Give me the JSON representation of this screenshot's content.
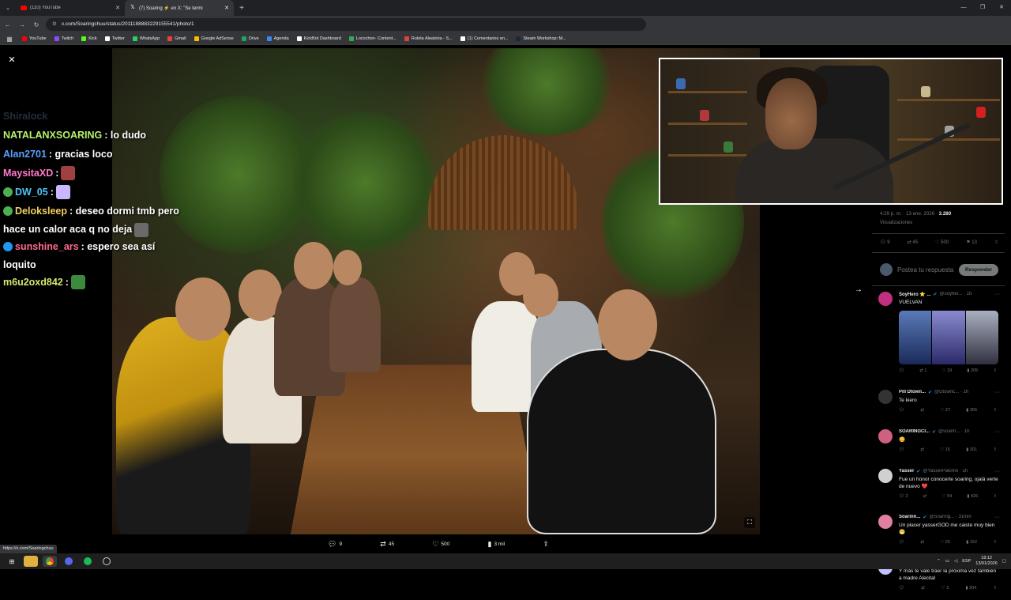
{
  "browser": {
    "tabs": [
      {
        "label": "(110) YouTube",
        "active": false,
        "icon": "youtube-icon"
      },
      {
        "label": "(7) Soaring ⚡ en X: \"Se termi",
        "active": true,
        "icon": "x-icon"
      }
    ],
    "url": "x.com/Soaringchuu/status/2011188883229155541/photo/1",
    "bookmarks": [
      {
        "label": "YouTube",
        "color": "#ff0000"
      },
      {
        "label": "Twitch",
        "color": "#9146ff"
      },
      {
        "label": "Kick",
        "color": "#53fc18"
      },
      {
        "label": "Twitter",
        "color": "#ffffff"
      },
      {
        "label": "WhatsApp",
        "color": "#25d366"
      },
      {
        "label": "Gmail",
        "color": "#ea4335"
      },
      {
        "label": "Google AdSense",
        "color": "#fbbc04"
      },
      {
        "label": "Drive",
        "color": "#1fa463"
      },
      {
        "label": "Agenda",
        "color": "#4285f4"
      },
      {
        "label": "KickBot Dashboard",
        "color": "#ffffff"
      },
      {
        "label": "Locochon- Content...",
        "color": "#34a853"
      },
      {
        "label": "Ruleta Aleatoria - S...",
        "color": "#e04040"
      },
      {
        "label": "(1) Comentarios en...",
        "color": "#ffffff"
      },
      {
        "label": "Steam Workshop::M...",
        "color": "#1b2838"
      }
    ]
  },
  "chat": {
    "messages": [
      {
        "user": "Shiralock",
        "text": "",
        "color": "#8ab4f8",
        "faded": true
      },
      {
        "user": "NATALANXSOARING",
        "text": ": lo dudo",
        "color": "#b7f36a"
      },
      {
        "user": "Alan2701",
        "text": ": gracias loco",
        "color": "#5aa0ff"
      },
      {
        "user": "MaysitaXD",
        "text": ":",
        "color": "#ff79c6",
        "emote": "#a04040"
      },
      {
        "user": "DW_05",
        "text": ":",
        "color": "#4fc3f7",
        "emote": "#c9b8ff",
        "badge": "#4caf50"
      },
      {
        "user": "Deloksleep",
        "text": ": deseo dormi tmb pero",
        "continuation": "hace un calor aca q no deja",
        "color": "#f0d060",
        "badge": "#4caf50",
        "emote_end": "#6a6a6a"
      },
      {
        "user": "sunshine_ars",
        "text": ": espero sea así",
        "continuation": "loquito",
        "color": "#ff6b8b",
        "badge": "#2196f3"
      },
      {
        "user": "m6u2oxd842",
        "text": ":",
        "color": "#d6e86a",
        "emote": "#3c8a3c"
      }
    ]
  },
  "photo": {
    "reply_count": "9",
    "repost_count": "45",
    "like_count": "500",
    "view_count": "3 mil"
  },
  "panel": {
    "timestamp": "4:29 p. m. · 13 ene. 2026 ·",
    "views_value": "3.280",
    "views_label": "Visualizaciones",
    "stats": {
      "replies": "9",
      "reposts": "45",
      "likes": "500",
      "bookmarks": "13"
    },
    "reply_placeholder": "Postea tu respuesta",
    "reply_button": "Responder",
    "tweets": [
      {
        "name": "SoyHero ⭐ ...",
        "handle": "@soyher... · 1h",
        "text": "VUELVAN",
        "replies": "",
        "reposts": "1",
        "likes": "19",
        "views": "205",
        "avatar": "#c03080",
        "has_media": true
      },
      {
        "name": "Pill Dtown...",
        "handle": "@Dtownc... · 1h",
        "text": "Te kiero",
        "replies": "",
        "reposts": "",
        "likes": "27",
        "views": "365",
        "avatar": "#333333"
      },
      {
        "name": "SOARINGCI...",
        "handle": "@soarin... · 1h",
        "text": "😋",
        "replies": "",
        "reposts": "",
        "likes": "15",
        "views": "301",
        "avatar": "#d06080"
      },
      {
        "name": "Yasser",
        "handle": "@YasserPalomo · 1h",
        "text": "Fue un honor conocerte soaring, ojalá verte de nuevo ❤️",
        "replies": "2",
        "reposts": "",
        "likes": "54",
        "views": "426",
        "avatar": "#d0d0d0"
      },
      {
        "name": "Soarinn...",
        "handle": "@Soaring... · 31min",
        "text": "Un placer yasserGOD me caiste muy bien 😁",
        "replies": "",
        "reposts": "",
        "likes": "25",
        "views": "152",
        "avatar": "#e080a0"
      },
      {
        "name": "DuskofRa ⚡🎯 ...",
        "handle": "@Du... · 1h",
        "text": "Y más te vale traer la próxima vez también a madre Alecita!",
        "replies": "",
        "reposts": "",
        "likes": "2",
        "views": "204",
        "avatar": "#c0c0ff"
      }
    ]
  },
  "status_url": "https://x.com/Soaringchuu",
  "taskbar": {
    "lang": "ESP",
    "time": "18:12",
    "date": "13/01/2026"
  }
}
